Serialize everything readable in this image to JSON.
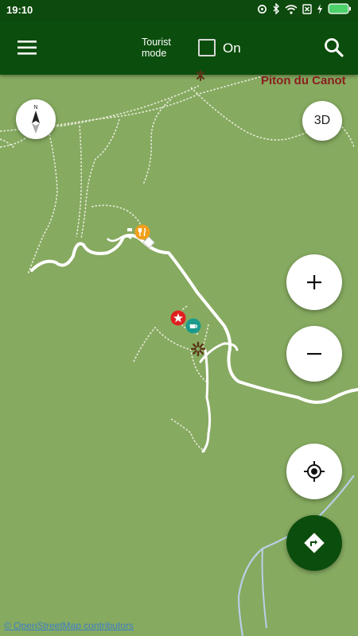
{
  "status_bar": {
    "time": "19:10"
  },
  "toolbar": {
    "tourist_mode_line1": "Tourist",
    "tourist_mode_line2": "mode",
    "toggle_label": "On",
    "toggle_checked": false
  },
  "map": {
    "place_labels": [
      "Piton du Canot"
    ],
    "controls": {
      "three_d_label": "3D",
      "compass_north_label": "N"
    },
    "attribution": "© OpenStreetMap contributors"
  },
  "colors": {
    "toolbar": "#0b4d0c",
    "map_background": "#86aa60",
    "road": "#ffffff",
    "label": "#8a1e1e",
    "route_button": "#0b4d0c"
  },
  "icons": [
    "menu-icon",
    "search-icon",
    "compass-icon",
    "zoom-in-icon",
    "zoom-out-icon",
    "my-location-icon",
    "directions-icon",
    "restaurant-icon",
    "star-icon",
    "cafe-icon",
    "viewpoint-icon"
  ]
}
